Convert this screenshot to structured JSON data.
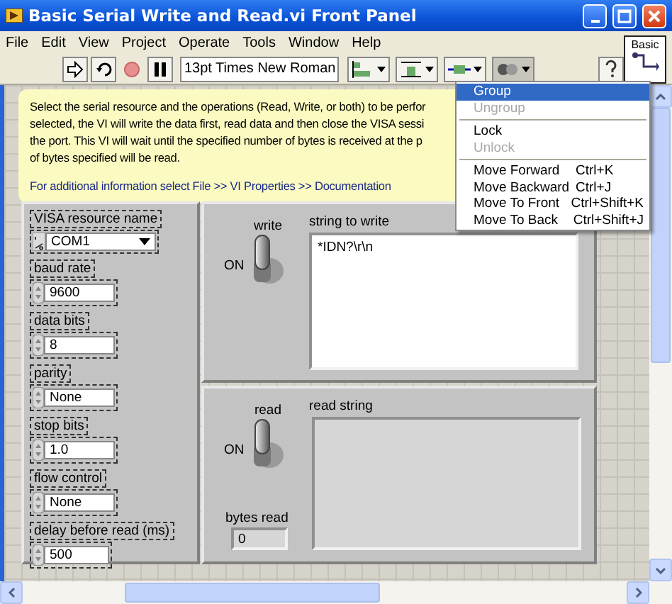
{
  "window": {
    "title": "Basic Serial Write and Read.vi Front Panel"
  },
  "menu": [
    "File",
    "Edit",
    "View",
    "Project",
    "Operate",
    "Tools",
    "Window",
    "Help"
  ],
  "palette": {
    "label": "Basic"
  },
  "toolbar": {
    "font": "13pt Times New Roman"
  },
  "description": {
    "lines": [
      "Select the serial resource and the operations (Read, Write, or both) to be perfor",
      "selected, the VI will write the data first, read data and then close the VISA sessi",
      "the port.  This VI will wait until the specified number of bytes is received at the p",
      "of bytes specified will be read."
    ],
    "link_line": "For additional information select File >> VI Properties >> Documentation"
  },
  "controls": [
    {
      "kind": "visa",
      "label": "VISA resource name",
      "value": "COM1"
    },
    {
      "kind": "numeric",
      "label": "baud rate",
      "value": "9600"
    },
    {
      "kind": "numeric",
      "label": "data bits",
      "value": "8"
    },
    {
      "kind": "ring",
      "label": "parity",
      "value": "None"
    },
    {
      "kind": "ring",
      "label": "stop bits",
      "value": "1.0"
    },
    {
      "kind": "ring",
      "label": "flow control",
      "value": "None"
    },
    {
      "kind": "numeric",
      "label": "delay before read (ms)",
      "value": "500"
    }
  ],
  "write": {
    "label": "write",
    "state_label": "ON",
    "on": true,
    "string_label": "string to write",
    "string_value": "*IDN?\\r\\n"
  },
  "read": {
    "label": "read",
    "state_label": "ON",
    "on": true,
    "string_label": "read string",
    "count_label": "bytes read",
    "count_value": "0"
  },
  "context_menu": [
    {
      "kind": "item",
      "label": "Group",
      "disabled": false,
      "selected": true
    },
    {
      "kind": "item",
      "label": "Ungroup",
      "disabled": true,
      "selected": false
    },
    {
      "kind": "separator"
    },
    {
      "kind": "item",
      "label": "Lock",
      "disabled": false,
      "selected": false
    },
    {
      "kind": "item",
      "label": "Unlock",
      "disabled": true,
      "selected": false
    },
    {
      "kind": "separator"
    },
    {
      "kind": "item",
      "label": "Move Forward",
      "shortcut": "Ctrl+K",
      "disabled": false,
      "selected": false
    },
    {
      "kind": "item",
      "label": "Move Backward",
      "shortcut": "Ctrl+J",
      "disabled": false,
      "selected": false
    },
    {
      "kind": "item",
      "label": "Move To Front",
      "shortcut": "Ctrl+Shift+K",
      "disabled": false,
      "selected": false
    },
    {
      "kind": "item",
      "label": "Move To Back",
      "shortcut": "Ctrl+Shift+J",
      "disabled": false,
      "selected": false
    }
  ]
}
